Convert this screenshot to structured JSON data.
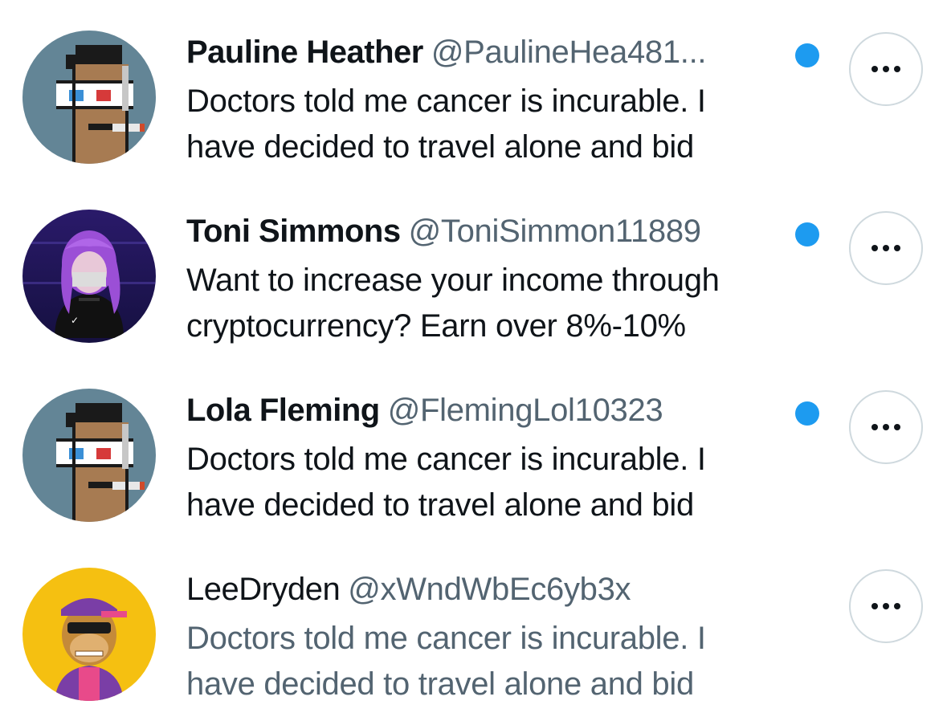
{
  "replies": [
    {
      "display_name": "Pauline Heather",
      "handle": "@PaulineHea481...",
      "verified": true,
      "text_lines": [
        "Doctors told me cancer is incurable. I",
        "have decided to travel alone and bid"
      ],
      "avatar": "pixel-punk-3d-glasses-icon",
      "more_icon": "more-options-icon"
    },
    {
      "display_name": "Toni Simmons",
      "handle": "@ToniSimmon11889",
      "verified": true,
      "text_lines": [
        "Want to increase your income through",
        "cryptocurrency? Earn over 8%-10%"
      ],
      "avatar": "anime-girl-purple-hair-icon",
      "more_icon": "more-options-icon"
    },
    {
      "display_name": "Lola Fleming",
      "handle": "@FlemingLol10323",
      "verified": true,
      "text_lines": [
        "Doctors told me cancer is incurable. I",
        "have decided to travel alone and bid"
      ],
      "avatar": "pixel-punk-3d-glasses-icon",
      "more_icon": "more-options-icon"
    },
    {
      "display_name": "LeeDryden",
      "handle": "@xWndWbEc6yb3x",
      "verified": false,
      "text_lines": [
        "Doctors told me cancer is incurable. I",
        "have decided to travel alone and bid"
      ],
      "avatar": "cartoon-ape-cap-icon",
      "more_icon": "more-options-icon"
    }
  ],
  "colors": {
    "text_primary": "#0f1419",
    "text_secondary": "#536471",
    "verified_blue": "#1d9bf0",
    "border": "#cfd9de"
  }
}
